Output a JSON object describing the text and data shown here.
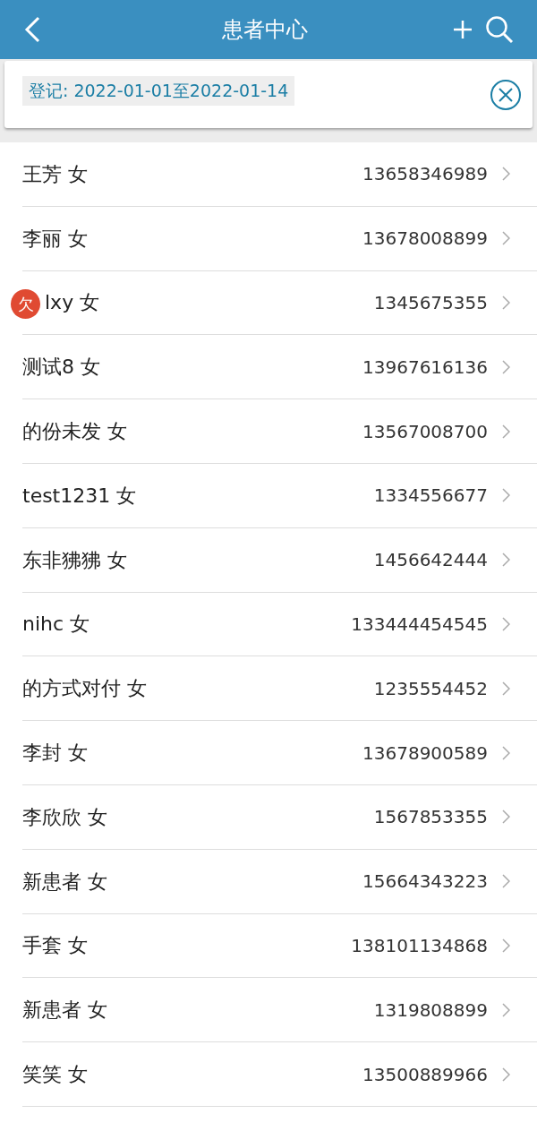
{
  "header": {
    "title": "患者中心"
  },
  "filter": {
    "text": "登记: 2022-01-01至2022-01-14"
  },
  "patients": [
    {
      "name": "王芳",
      "gender": "女",
      "phone": "13658346989"
    },
    {
      "name": "李丽",
      "gender": "女",
      "phone": "13678008899"
    },
    {
      "name": "lxy",
      "gender": "女",
      "phone": "1345675355",
      "badge": "欠"
    },
    {
      "name": "测试8",
      "gender": "女",
      "phone": "13967616136"
    },
    {
      "name": "的份未发",
      "gender": "女",
      "phone": "13567008700"
    },
    {
      "name": "test1231",
      "gender": "女",
      "phone": "1334556677"
    },
    {
      "name": "东非狒狒",
      "gender": "女",
      "phone": "1456642444"
    },
    {
      "name": "nihc",
      "gender": "女",
      "phone": "133444454545"
    },
    {
      "name": "的方式对付",
      "gender": "女",
      "phone": "1235554452"
    },
    {
      "name": "李封",
      "gender": "女",
      "phone": "13678900589"
    },
    {
      "name": "李欣欣",
      "gender": "女",
      "phone": "1567853355"
    },
    {
      "name": "新患者",
      "gender": "女",
      "phone": "15664343223"
    },
    {
      "name": "手套",
      "gender": "女",
      "phone": "138101134868"
    },
    {
      "name": "新患者",
      "gender": "女",
      "phone": "1319808899"
    },
    {
      "name": "笑笑",
      "gender": "女",
      "phone": "13500889966"
    }
  ]
}
